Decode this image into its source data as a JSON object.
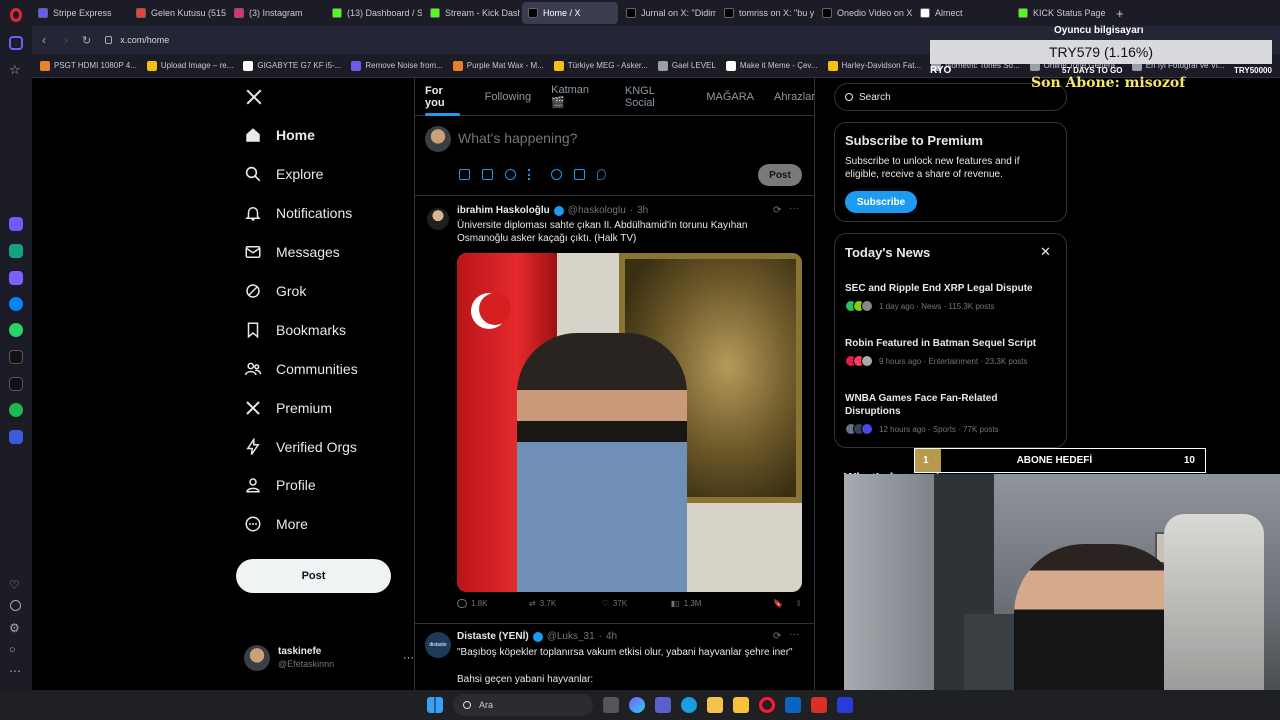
{
  "browser": {
    "tabs": [
      {
        "label": "Stripe Express",
        "color": "#635bff",
        "active": false
      },
      {
        "label": "Gelen Kutusu (515) -",
        "color": "#ea4335",
        "active": false
      },
      {
        "label": "(3) Instagram",
        "color": "#e1306c",
        "active": false
      },
      {
        "label": "(13) Dashboard / Stre",
        "color": "#53fc18",
        "active": false
      },
      {
        "label": "Stream - Kick Dashb",
        "color": "#53fc18",
        "active": false
      },
      {
        "label": "Home / X",
        "color": "#000000",
        "active": true
      },
      {
        "label": "Jurnal on X: \"Didim'd",
        "color": "#000000",
        "active": false
      },
      {
        "label": "tomriss on X: \"bu yat",
        "color": "#000000",
        "active": false
      },
      {
        "label": "Onedio Video on X: \"",
        "color": "#000000",
        "active": false
      },
      {
        "label": "Almect",
        "color": "#ffffff",
        "active": false
      },
      {
        "label": "KICK Status Page",
        "color": "#53fc18",
        "active": false
      }
    ],
    "url": "x.com/home",
    "bookmarks": [
      {
        "label": "PSGT HDMI 1080P 4...",
        "color": "#e8812b"
      },
      {
        "label": "Upload Image – re...",
        "color": "#f4c20d"
      },
      {
        "label": "GIGABYTE G7 KF i5-...",
        "color": "#ffffff"
      },
      {
        "label": "Remove Noise from...",
        "color": "#6c5ce7"
      },
      {
        "label": "Purple Mat Wax - M...",
        "color": "#e8812b"
      },
      {
        "label": "Türkiye MEG - Asker...",
        "color": "#f4c20d"
      },
      {
        "label": "Gael LEVEL",
        "color": "#9aa0a6"
      },
      {
        "label": "Make it Meme - Çev...",
        "color": "#ffffff"
      },
      {
        "label": "Harley-Davidson Fat...",
        "color": "#f4c20d"
      },
      {
        "label": "Isometric Tones So...",
        "color": "#9aa0a6"
      },
      {
        "label": "Online Tone Genera...",
        "color": "#9aa0a6"
      },
      {
        "label": "En İyi Fotoğraf ve Vi...",
        "color": "#9aa0a6"
      }
    ]
  },
  "nav": {
    "items": [
      {
        "label": "Home",
        "icon": "home-icon",
        "bold": true
      },
      {
        "label": "Explore",
        "icon": "search-icon"
      },
      {
        "label": "Notifications",
        "icon": "bell-icon"
      },
      {
        "label": "Messages",
        "icon": "envelope-icon"
      },
      {
        "label": "Grok",
        "icon": "grok-icon"
      },
      {
        "label": "Bookmarks",
        "icon": "bookmark-icon"
      },
      {
        "label": "Communities",
        "icon": "people-icon"
      },
      {
        "label": "Premium",
        "icon": "x-icon"
      },
      {
        "label": "Verified Orgs",
        "icon": "bolt-icon"
      },
      {
        "label": "Profile",
        "icon": "person-icon"
      },
      {
        "label": "More",
        "icon": "more-circle-icon"
      }
    ],
    "post_button": "Post",
    "account": {
      "name": "taskinefe",
      "handle": "@Efetaskinnn"
    }
  },
  "feed": {
    "tabs": [
      "For you",
      "Following",
      "Katman 🎬",
      "KNGL Social",
      "MAĞARA",
      "Ahrazlar"
    ],
    "compose_placeholder": "What's happening?",
    "compose_post": "Post",
    "tweets": [
      {
        "name": "ibrahim Haskoloğlu",
        "handle": "@haskologlu",
        "time": "3h",
        "text": "Üniversite diploması sahte çıkan II. Abdülhamid'in torunu Kayıhan Osmanoğlu asker kaçağı çıktı. (Halk TV)",
        "replies": "1.8K",
        "reposts": "3.7K",
        "likes": "37K",
        "views": "1.3M"
      },
      {
        "name": "Distaste (YENİ)",
        "handle": "@Luks_31",
        "time": "4h",
        "text": "\"Başıboş köpekler toplanırsa vakum etkisi olur, yabani hayvanlar şehre iner\"",
        "text2": "Bahsi geçen yabani hayvanlar:",
        "avatar_label": "distaste"
      }
    ]
  },
  "right": {
    "search_placeholder": "Search",
    "premium": {
      "title": "Subscribe to Premium",
      "text": "Subscribe to unlock new features and if eligible, receive a share of revenue.",
      "button": "Subscribe"
    },
    "news": {
      "title": "Today's News",
      "items": [
        {
          "title": "SEC and Ripple End XRP Legal Dispute",
          "meta": "1 day ago · News · 115.3K posts"
        },
        {
          "title": "Robin Featured in Batman Sequel Script",
          "meta": "9 hours ago · Entertainment · 23.3K posts"
        },
        {
          "title": "WNBA Games Face Fan-Related Disruptions",
          "meta": "12 hours ago · Sports · 77K posts"
        }
      ]
    },
    "whats_happening": "What's happening"
  },
  "overlay": {
    "header": "Oyuncu bilgisayarı",
    "currency": "TRY579 (1.16%)",
    "left_tag": "RYO",
    "days": "57 DAYS TO GO",
    "right_tag": "TRY50000",
    "subscriber": "Son Abone: misozof",
    "goal_current": "1",
    "goal_label": "ABONE HEDEFİ",
    "goal_target": "10"
  },
  "taskbar": {
    "search_label": "Ara"
  },
  "colors": {
    "accent": "#1d9bf0",
    "border": "#2f3336",
    "muted": "#71767b",
    "kick_green": "#53fc18",
    "overlay_yellow": "#f5e663"
  }
}
